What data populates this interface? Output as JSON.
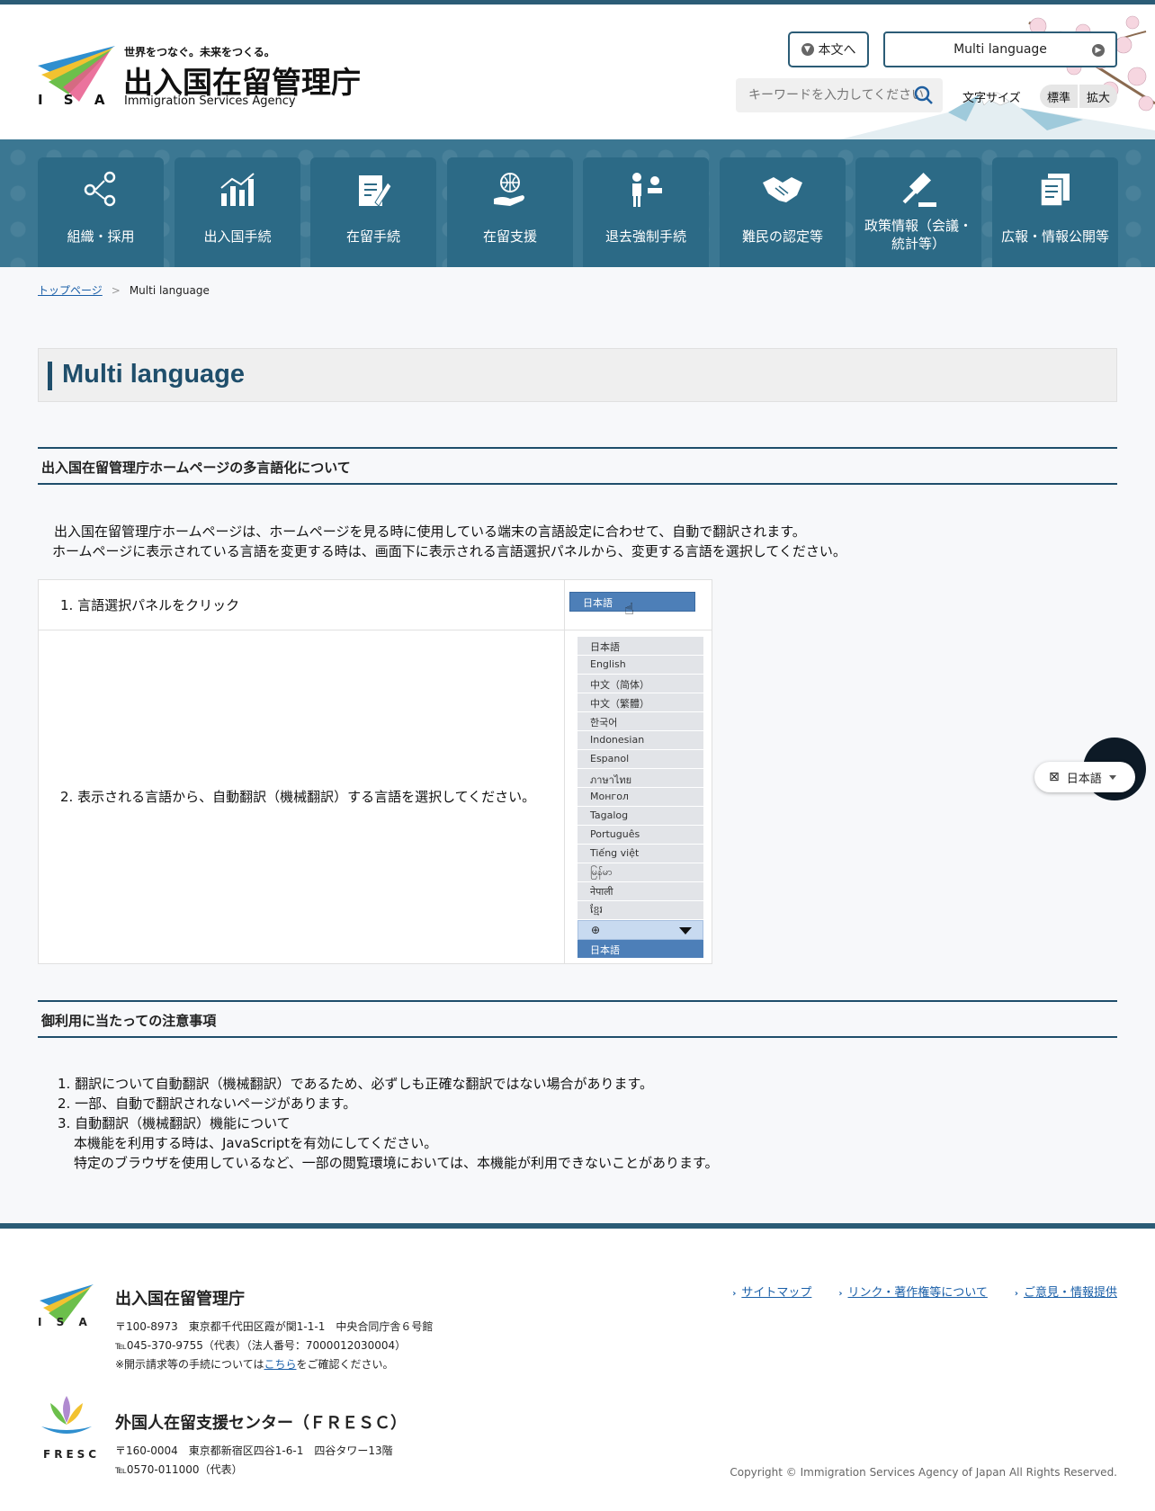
{
  "header": {
    "tagline": "世界をつなぐ。未来をつくる。",
    "agency_name": "出入国在留管理庁",
    "agency_en": "Immigration Services Agency",
    "isa_letters": "I S A",
    "skip_label": "本文へ",
    "multi_language_label": "Multi language",
    "search_placeholder": "キーワードを入力してください",
    "fontsize_label": "文字サイズ",
    "fontsize_standard": "標準",
    "fontsize_large": "拡大"
  },
  "nav": {
    "items": [
      {
        "label": "組織・採用"
      },
      {
        "label": "出入国手続"
      },
      {
        "label": "在留手続"
      },
      {
        "label": "在留支援"
      },
      {
        "label": "退去強制手続"
      },
      {
        "label": "難民の認定等"
      },
      {
        "label": "政策情報（会議・統計等）",
        "line1": "政策情報（会議・",
        "line2": "統計等）"
      },
      {
        "label": "広報・情報公開等"
      }
    ]
  },
  "breadcrumb": {
    "home": "トップページ",
    "current": "Multi language"
  },
  "page_title": "Multi language",
  "section1": {
    "heading": "出入国在留管理庁ホームページの多言語化について",
    "line1": "出入国在留管理庁ホームページは、ホームページを見る時に使用している端末の言語設定に合わせて、自動で翻訳されます。",
    "line2": "ホームページに表示されている言語を変更する時は、画面下に表示される言語選択パネルから、変更する言語を選択してください。"
  },
  "steps": {
    "step1": "1. 言語選択パネルをクリック",
    "step2": "2. 表示される言語から、自動翻訳（機械翻訳）する言語を選択してください。",
    "panel_value": "日本語",
    "languages": [
      "日本語",
      "English",
      "中文（简体）",
      "中文（繁體）",
      "한국어",
      "Indonesian",
      "Espanol",
      "ภาษาไทย",
      "Монгол",
      "Tagalog",
      "Português",
      "Tiếng việt",
      "မြန်မာ",
      "नेपाली",
      "ខ្មែរ"
    ],
    "selected_language": "日本語"
  },
  "floating_translate": {
    "label": "日本語"
  },
  "section2": {
    "heading": "御利用に当たっての注意事項",
    "note1": "1. 翻訳について自動翻訳（機械翻訳）であるため、必ずしも正確な翻訳ではない場合があります。",
    "note2": "2. 一部、自動で翻訳されないページがあります。",
    "note3": "3. 自動翻訳（機械翻訳）機能について",
    "note3a": "本機能を利用する時は、JavaScriptを有効にしてください。",
    "note3b": "特定のブラウザを使用しているなど、一部の閲覧環境においては、本機能が利用できないことがあります。"
  },
  "footer": {
    "isa_letters": "I S A",
    "name": "出入国在留管理庁",
    "address": "〒100-8973　東京都千代田区霞が関1-1-1　中央合同庁舎６号館",
    "tel": "℡045-370-9755（代表）（法人番号：7000012030004）",
    "disclosure_prefix": "※開示請求等の手続については",
    "disclosure_link": "こちら",
    "disclosure_suffix": "をご確認ください。",
    "links": [
      "サイトマップ",
      "リンク・著作権等について",
      "ご意見・情報提供"
    ],
    "fresc_letters": "FRESC",
    "fresc_name": "外国人在留支援センター（ＦＲＥＳＣ）",
    "fresc_address": "〒160-0004　東京都新宿区四谷1-6-1　四谷タワー13階",
    "fresc_tel": "℡0570-011000（代表）",
    "copyright": "Copyright © Immigration Services Agency of Japan All Rights Reserved."
  },
  "colors": {
    "primary": "#2b5c76",
    "nav_bg": "#3b7792",
    "nav_item": "#2c6a86",
    "link": "#1a5fa8"
  }
}
